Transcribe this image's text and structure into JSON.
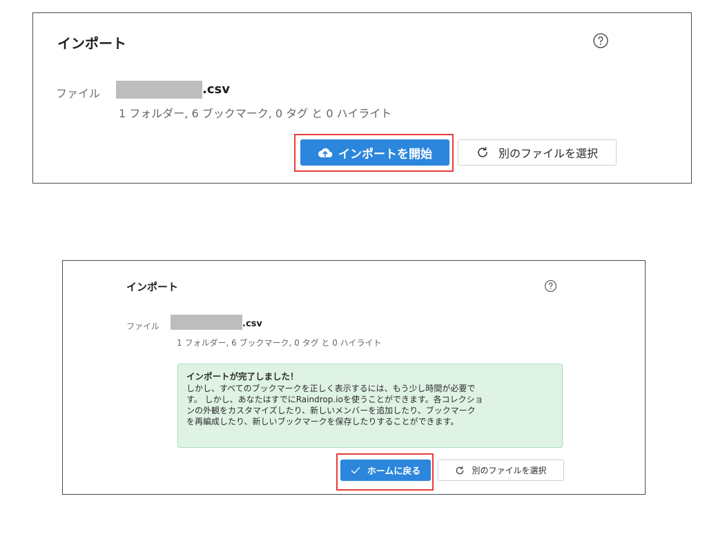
{
  "top_panel": {
    "title": "インポート",
    "help_icon": "question-circle-icon",
    "file_label": "ファイル",
    "file_ext": ".csv",
    "file_summary": "1 フォルダー, 6 ブックマーク, 0 タグ と 0 ハイライト",
    "start_button": {
      "icon": "cloud-upload-icon",
      "label": "インポートを開始"
    },
    "choose_other_button": {
      "icon": "refresh-icon",
      "label": "別のファイルを選択"
    }
  },
  "bottom_panel": {
    "title": "インポート",
    "help_icon": "question-circle-icon",
    "file_label": "ファイル",
    "file_ext": ".csv",
    "file_summary": "1 フォルダー, 6 ブックマーク, 0 タグ と 0 ハイライト",
    "success": {
      "title": "インポートが完了しました！",
      "body": "しかし、すべてのブックマークを正しく表示するには、もう少し時間が必要で\nす。 しかし、あなたはすでにRaindrop.ioを使うことができます。各コレクショ\nンの外観をカスタマイズしたり、新しいメンバーを追加したり、ブックマーク\nを再編成したり、新しいブックマークを保存したりすることができます。"
    },
    "home_button": {
      "icon": "check-icon",
      "label": "ホームに戻る"
    },
    "choose_other_button": {
      "icon": "refresh-icon",
      "label": "別のファイルを選択"
    }
  },
  "colors": {
    "primary": "#2b86dc",
    "highlight": "#e83a3a",
    "success_bg": "#dff3e5",
    "success_border": "#a9dcb8",
    "redaction": "#bdbdbd"
  }
}
